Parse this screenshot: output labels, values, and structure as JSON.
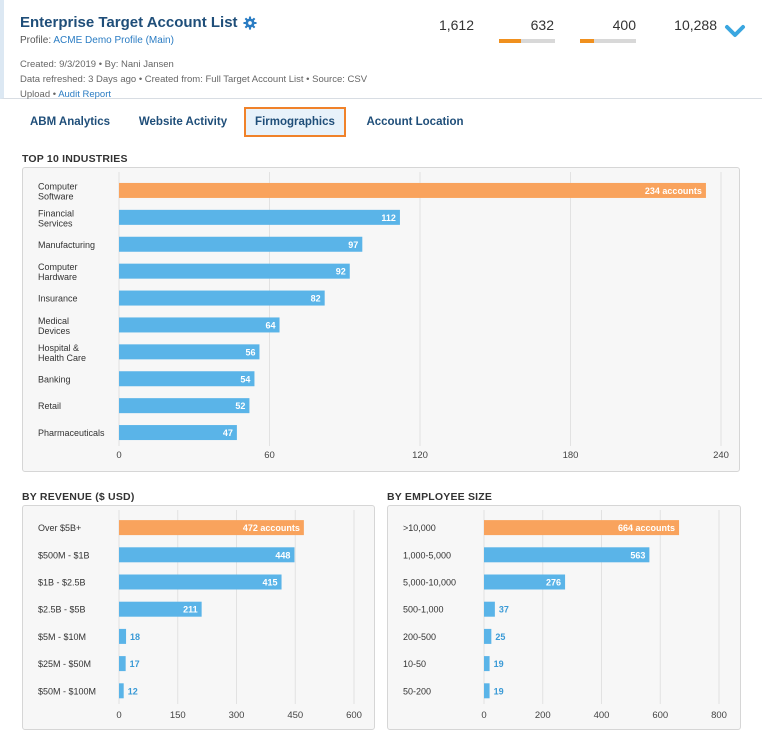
{
  "header": {
    "title": "Enterprise Target Account List",
    "profile_label": "Profile: ",
    "profile_link": "ACME Demo Profile (Main)",
    "meta_line1": "Created: 9/3/2019 • By: Nani Jansen",
    "meta_line2": "Data refreshed: 3 Days ago • Created from: Full Target Account List • Source: CSV",
    "meta_line3_prefix": "Upload • ",
    "meta_link": "Audit Report",
    "stats": [
      {
        "value": "1,612",
        "progress": null
      },
      {
        "value": "632",
        "progress": 0.39
      },
      {
        "value": "400",
        "progress": 0.25
      },
      {
        "value": "10,288",
        "progress": null
      }
    ]
  },
  "tabs": [
    "ABM Analytics",
    "Website Activity",
    "Firmographics",
    "Account Location"
  ],
  "active_tab": "Firmographics",
  "sections": {
    "industries_title": "TOP 10 INDUSTRIES",
    "revenue_title": "BY REVENUE ($ USD)",
    "employee_title": "BY EMPLOYEE SIZE"
  },
  "colors": {
    "highlight": "#f9a35d",
    "bar": "#5ab4e8",
    "label_outside": "#3a9ad6",
    "grid": "#e2e2e2"
  },
  "chart_data": [
    {
      "id": "industries",
      "type": "bar",
      "orientation": "horizontal",
      "categories": [
        [
          "Computer",
          "Software"
        ],
        [
          "Financial",
          "Services"
        ],
        [
          "Manufacturing"
        ],
        [
          "Computer",
          "Hardware"
        ],
        [
          "Insurance"
        ],
        [
          "Medical",
          "Devices"
        ],
        [
          "Hospital &",
          "Health Care"
        ],
        [
          "Banking"
        ],
        [
          "Retail"
        ],
        [
          "Pharmaceuticals"
        ]
      ],
      "values": [
        234,
        112,
        97,
        92,
        82,
        64,
        56,
        54,
        52,
        47
      ],
      "value_labels": [
        "234 accounts",
        "112",
        "97",
        "92",
        "82",
        "64",
        "56",
        "54",
        "52",
        "47"
      ],
      "xlim": [
        0,
        240
      ],
      "ticks": [
        0,
        60,
        120,
        180,
        240
      ],
      "highlight_index": 0
    },
    {
      "id": "revenue",
      "type": "bar",
      "orientation": "horizontal",
      "categories": [
        [
          "Over $5B+"
        ],
        [
          "$500M - $1B"
        ],
        [
          "$1B - $2.5B"
        ],
        [
          "$2.5B - $5B"
        ],
        [
          "$5M - $10M"
        ],
        [
          "$25M - $50M"
        ],
        [
          "$50M - $100M"
        ]
      ],
      "values": [
        472,
        448,
        415,
        211,
        18,
        17,
        12
      ],
      "value_labels": [
        "472 accounts",
        "448",
        "415",
        "211",
        "18",
        "17",
        "12"
      ],
      "xlim": [
        0,
        600
      ],
      "ticks": [
        0,
        150,
        300,
        450,
        600
      ],
      "highlight_index": 0
    },
    {
      "id": "employees",
      "type": "bar",
      "orientation": "horizontal",
      "categories": [
        [
          ">10,000"
        ],
        [
          "1,000-5,000"
        ],
        [
          "5,000-10,000"
        ],
        [
          "500-1,000"
        ],
        [
          "200-500"
        ],
        [
          "10-50"
        ],
        [
          "50-200"
        ]
      ],
      "values": [
        664,
        563,
        276,
        37,
        25,
        19,
        19
      ],
      "value_labels": [
        "664 accounts",
        "563",
        "276",
        "37",
        "25",
        "19",
        "19"
      ],
      "xlim": [
        0,
        800
      ],
      "ticks": [
        0,
        200,
        400,
        600,
        800
      ],
      "highlight_index": 0
    }
  ]
}
